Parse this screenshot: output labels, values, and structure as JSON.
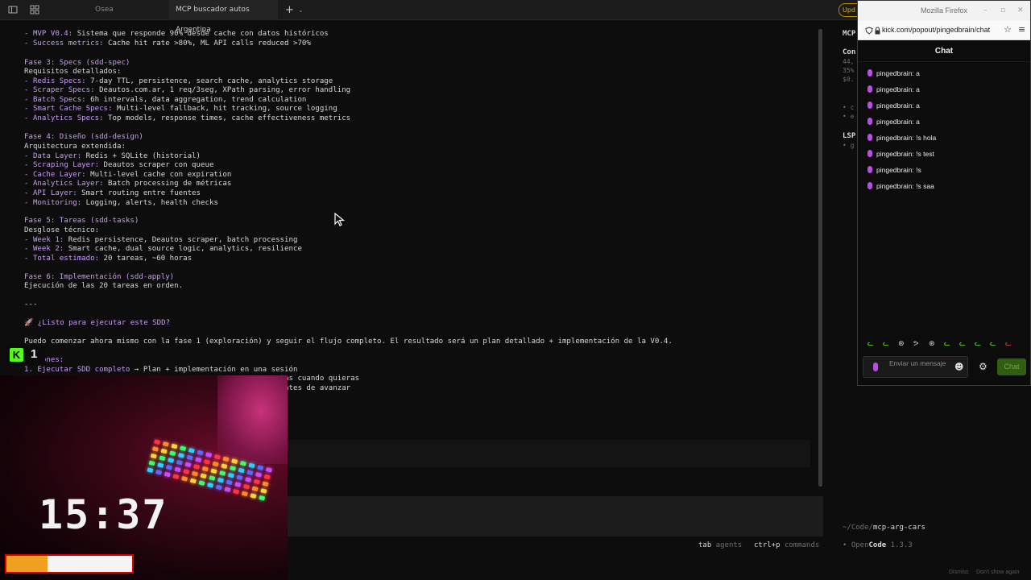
{
  "browser": {
    "tabs": [
      {
        "label": "Osea",
        "active": false
      },
      {
        "label": "MCP buscador autos Argentina",
        "active": true
      }
    ],
    "update_badge": "Upd"
  },
  "terminal": {
    "lines": [
      {
        "label": "- MVP V0.4:",
        "text": " Sistema que responde 90% desde cache con datos históricos"
      },
      {
        "label": "- Success metrics:",
        "text": " Cache hit rate >80%, ML API calls reduced >70%"
      },
      {
        "label": "",
        "text": ""
      },
      {
        "label": "Fase 3: Specs (sdd-spec)",
        "text": ""
      },
      {
        "label": "",
        "text": "Requisitos detallados:"
      },
      {
        "label": "- Redis Specs:",
        "text": " 7-day TTL, persistence, search cache, analytics storage"
      },
      {
        "label": "- Scraper Specs:",
        "text": " Deautos.com.ar, 1 req/3seg, XPath parsing, error handling"
      },
      {
        "label": "- Batch Specs:",
        "text": " 6h intervals, data aggregation, trend calculation"
      },
      {
        "label": "- Smart Cache Specs:",
        "text": " Multi-level fallback, hit tracking, source logging"
      },
      {
        "label": "- Analytics Specs:",
        "text": " Top models, response times, cache effectiveness metrics"
      },
      {
        "label": "",
        "text": ""
      },
      {
        "label": "Fase 4: Diseño (sdd-design)",
        "text": ""
      },
      {
        "label": "",
        "text": "Arquitectura extendida:"
      },
      {
        "label": "- Data Layer:",
        "text": " Redis + SQLite (historial)"
      },
      {
        "label": "- Scraping Layer:",
        "text": " Deautos scraper con queue"
      },
      {
        "label": "- Cache Layer:",
        "text": " Multi-level cache con expiration"
      },
      {
        "label": "- Analytics Layer:",
        "text": " Batch processing de métricas"
      },
      {
        "label": "- API Layer:",
        "text": " Smart routing entre fuentes"
      },
      {
        "label": "- Monitoring:",
        "text": " Logging, alerts, health checks"
      },
      {
        "label": "",
        "text": ""
      },
      {
        "label": "Fase 5: Tareas (sdd-tasks)",
        "text": ""
      },
      {
        "label": "",
        "text": "Desglose técnico:"
      },
      {
        "label": "- Week 1:",
        "text": " Redis persistence, Deautos scraper, batch processing"
      },
      {
        "label": "- Week 2:",
        "text": " Smart cache, dual source logic, analytics, resilience"
      },
      {
        "label": "- Total estimado:",
        "text": " 20 tareas, ~60 horas"
      },
      {
        "label": "",
        "text": ""
      },
      {
        "label": "Fase 6: Implementación (sdd-apply)",
        "text": ""
      },
      {
        "label": "",
        "text": "Ejecución de las 20 tareas en orden."
      },
      {
        "label": "",
        "text": ""
      },
      {
        "label": "",
        "text": "---"
      },
      {
        "label": "",
        "text": ""
      },
      {
        "label": "🚀 ¿Listo para ejecutar este SDD?",
        "text": ""
      },
      {
        "label": "",
        "text": ""
      },
      {
        "label": "",
        "text": "Puedo comenzar ahora mismo con la fase 1 (exploración) y seguir el flujo completo. El resultado será un plan detallado + implementación de la V0.4."
      },
      {
        "label": "",
        "text": ""
      },
      {
        "label": "Opciones:",
        "text": ""
      },
      {
        "label": "1. Ejecutar SDD completo",
        "text": " → Plan + implementación en una sesión"
      },
      {
        "label": "",
        "text": "                                                          tas cuando quieras"
      },
      {
        "label": "",
        "text": "                                                          antes de avanzar"
      }
    ],
    "shortcuts": [
      {
        "key": "tab",
        "desc": "agents"
      },
      {
        "key": "ctrl+p",
        "desc": "commands"
      }
    ]
  },
  "side_panel": {
    "heading1": "MCP",
    "block": [
      "Con",
      "44,",
      "35%",
      "$0."
    ],
    "bullets": [
      "• c",
      "• e"
    ],
    "lsp": "LSP",
    "lsp_sub": "• g",
    "path_prefix": "~/Code/",
    "path": "mcp-arg-cars",
    "app_name_a": "• Open",
    "app_name_b": "Code",
    "version": "1.3.3",
    "dismiss": "Dismiss",
    "dont_show": "Don't show again"
  },
  "stream_overlay": {
    "clock": "15:37",
    "viewer_count": "1",
    "kick_letter": "K",
    "progress": 0.33
  },
  "firefox": {
    "window_title": "Mozilla Firefox",
    "url": "kick.com/popout/pingedbrain/chat",
    "chat_title": "Chat",
    "messages": [
      {
        "user": "pingedbrain:",
        "text": "a"
      },
      {
        "user": "pingedbrain:",
        "text": "a"
      },
      {
        "user": "pingedbrain:",
        "text": "a"
      },
      {
        "user": "pingedbrain:",
        "text": "a"
      },
      {
        "user": "pingedbrain:",
        "text": "!s hola"
      },
      {
        "user": "pingedbrain:",
        "text": "!s test"
      },
      {
        "user": "pingedbrain:",
        "text": "!s"
      },
      {
        "user": "pingedbrain:",
        "text": "!s saa"
      }
    ],
    "input_placeholder": "Enviar un mensaje",
    "send_button": "Chat",
    "accent": "#53fc18"
  }
}
